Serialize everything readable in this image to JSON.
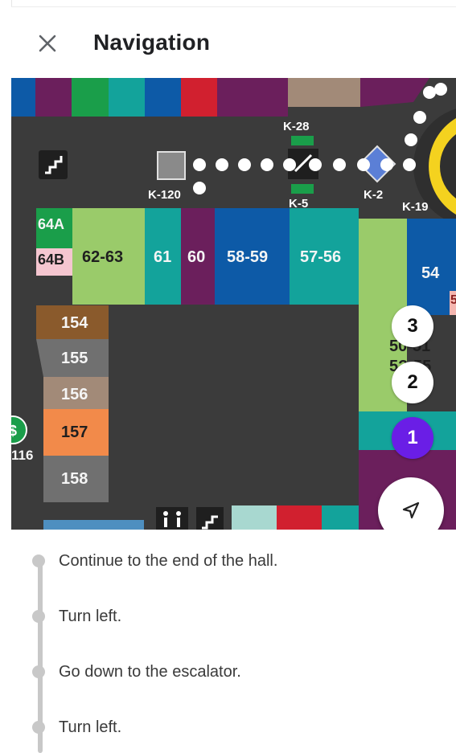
{
  "header": {
    "title": "Navigation",
    "close_icon": "close-icon"
  },
  "map": {
    "stores": [
      "64A",
      "64B",
      "62-63",
      "61",
      "60",
      "58-59",
      "57-56",
      "54",
      "5",
      "154",
      "155",
      "156",
      "157",
      "158",
      "116",
      "50-51",
      "5?-55"
    ],
    "kiosks": [
      "K-28",
      "K-120",
      "K-5",
      "K-2",
      "K-19"
    ],
    "step_markers": [
      "3",
      "2",
      "1"
    ],
    "active_step": "1",
    "icons": [
      "stairs-icon",
      "escalator-icon",
      "atm-icon",
      "restroom-icon",
      "locate-icon"
    ],
    "colors": {
      "route": "#ffffff",
      "active_marker": "#6a1ee6",
      "floor": "#3b3b3b"
    }
  },
  "steps": [
    {
      "text": "Continue to the end of the hall."
    },
    {
      "text": "Turn left."
    },
    {
      "text": "Go down to the escalator."
    },
    {
      "text": "Turn left."
    }
  ]
}
